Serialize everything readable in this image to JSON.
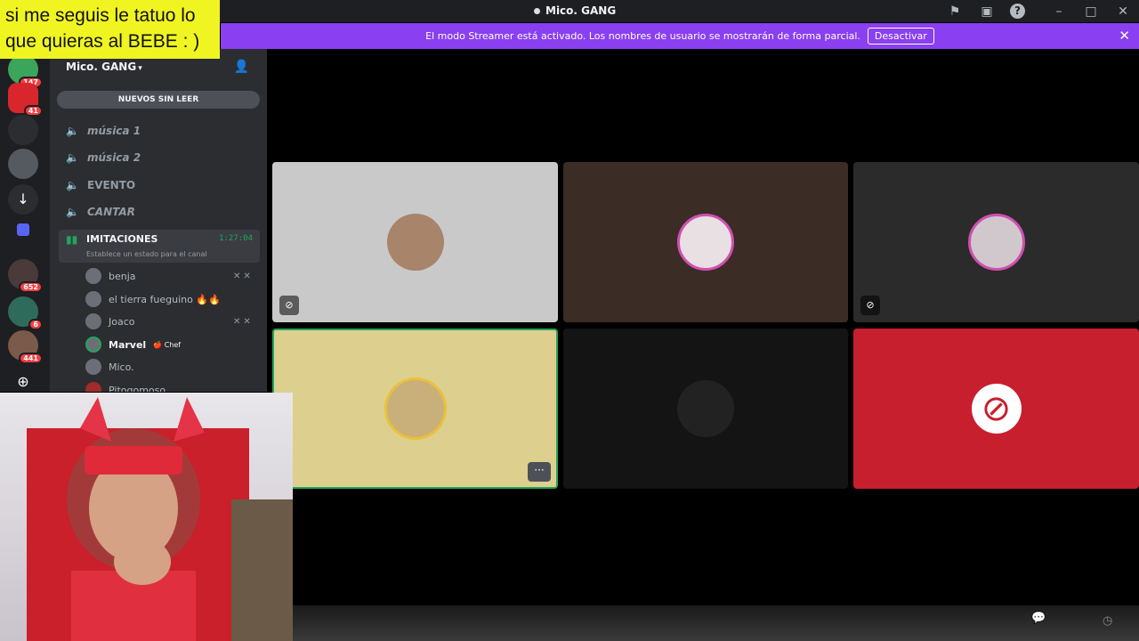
{
  "overlay": {
    "text": "si me seguis le tatuo lo que quieras al BEBE : )"
  },
  "titlebar": {
    "title": "Mico. GANG",
    "icons": [
      "flag-icon",
      "inbox-icon",
      "help-icon",
      "minimize-icon",
      "maximize-icon",
      "close-icon"
    ]
  },
  "banner": {
    "text": "El modo Streamer está activado. Los nombres de usuario se mostrarán de forma parcial.",
    "button": "Desactivar",
    "bg": "#8a3ff0"
  },
  "servers": [
    {
      "badge": "147",
      "color": "#3ba55c"
    },
    {
      "badge": "41",
      "color": "#d9262d"
    },
    {
      "badge": "",
      "color": "#2b2d31"
    },
    {
      "badge": "",
      "color": "#555a60"
    },
    {
      "badge": "",
      "color": "#2b2d31"
    },
    {
      "badge": "",
      "color": "#5865f2"
    },
    {
      "badge": "652",
      "color": "#4a3a3a"
    },
    {
      "badge": "6",
      "color": "#2f6b5a"
    },
    {
      "badge": "441",
      "color": "#7a5a4a"
    }
  ],
  "sidebar": {
    "guild_name": "Mico. GANG",
    "unread_label": "NUEVOS SIN LEER",
    "channels": [
      {
        "name": "música 1",
        "style": "italic"
      },
      {
        "name": "música 2",
        "style": "italic"
      },
      {
        "name": "EVENTO",
        "style": "plain"
      },
      {
        "name": "CANTAR",
        "style": "italic"
      }
    ],
    "active_channel": {
      "name": "IMITACIONES",
      "time": "1:27:04",
      "status": "Establece un estado para el canal"
    },
    "members": [
      {
        "name": "benja",
        "muted": true,
        "speaking": false,
        "tag": ""
      },
      {
        "name": "el tierra fueguino 🔥🔥",
        "muted": false,
        "speaking": false,
        "tag": ""
      },
      {
        "name": "Joaco",
        "muted": true,
        "speaking": false,
        "tag": ""
      },
      {
        "name": "Marvel",
        "muted": false,
        "speaking": true,
        "tag": "🍎 Chef"
      },
      {
        "name": "Mico.",
        "muted": false,
        "speaking": false,
        "tag": ""
      },
      {
        "name": "Pitogomoso",
        "muted": false,
        "speaking": false,
        "tag": ""
      }
    ]
  },
  "tiles": [
    {
      "bg": "#c9c9c9",
      "avatar_color": "#a7846a",
      "indicator": "deafened-icon",
      "speaking": false
    },
    {
      "bg": "#3b2c26",
      "avatar_color": "#e8e0e2",
      "indicator": "",
      "speaking": false
    },
    {
      "bg": "#2b2b2b",
      "avatar_color": "#d0c8cc",
      "indicator": "deafened-icon",
      "speaking": false
    },
    {
      "bg": "#ddd08f",
      "avatar_color": "#c9b07a",
      "indicator": "more-icon",
      "speaking": true
    },
    {
      "bg": "#141414",
      "avatar_color": "#222222",
      "indicator": "",
      "speaking": false
    },
    {
      "bg": "#c81f2e",
      "avatar_color": "#ffffff",
      "indicator": "",
      "speaking": false
    }
  ]
}
